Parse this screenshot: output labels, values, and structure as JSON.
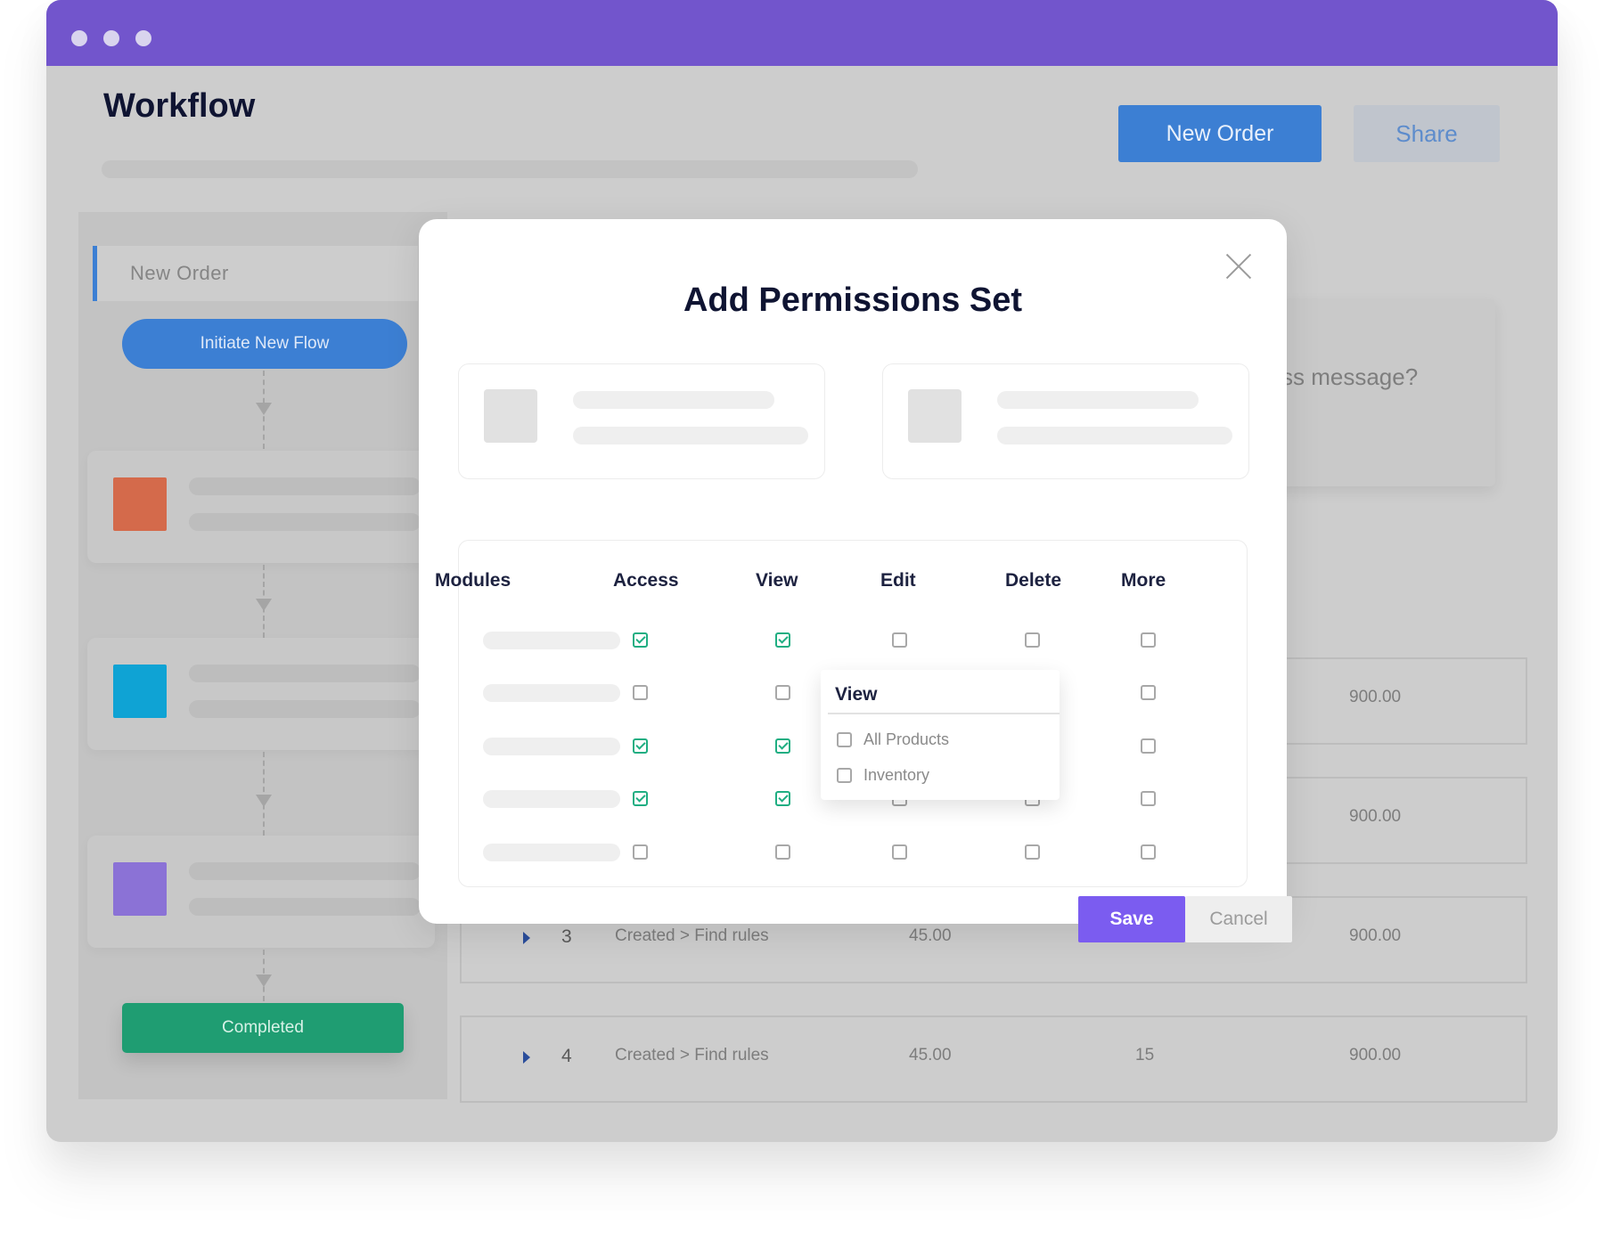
{
  "header": {
    "title": "Workflow",
    "new_order_label": "New Order",
    "share_label": "Share"
  },
  "sidebar": {
    "tab_label": "New Order",
    "initiate_label": "Initiate New Flow",
    "completed_label": "Completed",
    "step_colors": [
      "#d46a4b",
      "#0fa3d4",
      "#8b72d6"
    ]
  },
  "background_card": {
    "text": "ss message?"
  },
  "orders": [
    {
      "num": "3",
      "status": "Created > Find rules",
      "price": "45.00",
      "qty": "",
      "total": "900.00"
    },
    {
      "num": "4",
      "status": "Created > Find rules",
      "price": "45.00",
      "qty": "15",
      "total": "900.00"
    }
  ],
  "order_totals_partial": [
    "900.00",
    "900.00"
  ],
  "modal": {
    "title": "Add Permissions Set",
    "columns": [
      "Modules",
      "Access",
      "View",
      "Edit",
      "Delete",
      "More"
    ],
    "rows": [
      [
        true,
        true,
        false,
        false,
        false
      ],
      [
        false,
        false,
        false,
        false,
        false
      ],
      [
        true,
        true,
        false,
        false,
        false
      ],
      [
        true,
        true,
        false,
        false,
        false
      ],
      [
        false,
        false,
        false,
        false,
        false
      ]
    ],
    "dropdown": {
      "title": "View",
      "options": [
        "All Products",
        "Inventory"
      ]
    },
    "save_label": "Save",
    "cancel_label": "Cancel"
  },
  "colors": {
    "titlebar": "#7255cc",
    "primary": "#3c7fd3",
    "success": "#1f9d72",
    "save": "#7b5cf0",
    "check": "#1fae82"
  }
}
